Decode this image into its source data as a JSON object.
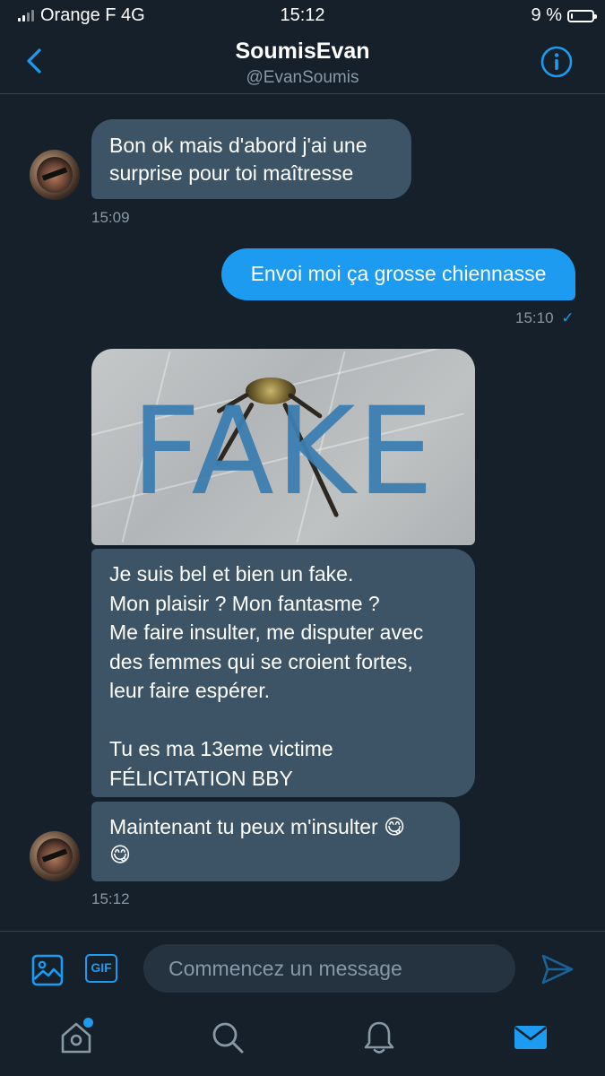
{
  "status_bar": {
    "carrier": "Orange F",
    "network": "4G",
    "time": "15:12",
    "battery": "9 %",
    "battery_level_percent": 9
  },
  "header": {
    "title": "SoumisEvan",
    "handle": "@EvanSoumis",
    "back_icon": "chevron-left-icon",
    "info_icon": "info-icon"
  },
  "messages": [
    {
      "from": "them",
      "text": "Bon ok mais d'abord j'ai une\nsurprise pour toi maîtresse",
      "time": "15:09"
    },
    {
      "from": "me",
      "text": "Envoi moi ça grosse chiennasse",
      "time": "15:10",
      "status": "✓"
    },
    {
      "from": "them",
      "media_text": "FAKE",
      "text": "Je suis bel et bien un fake.\nMon plaisir ? Mon fantasme ?\nMe faire insulter, me disputer avec\ndes femmes qui se croient fortes,\nleur faire espérer.\n\nTu es ma 13eme victime\nFÉLICITATION BBY"
    },
    {
      "from": "them",
      "text": "Maintenant tu peux m'insulter 😋\n😋",
      "time": "15:12"
    }
  ],
  "composer": {
    "placeholder": "Commencez un message",
    "gif_label": "GIF",
    "image_icon": "image-icon",
    "send_icon": "send-icon"
  },
  "tabbar": {
    "items": [
      "home-icon",
      "search-icon",
      "bell-icon",
      "mail-icon"
    ],
    "active": "mail-icon"
  },
  "colors": {
    "background": "#15202b",
    "accent": "#1d9bf0",
    "incoming_bubble": "#3d5466",
    "muted_text": "#8899a6"
  }
}
